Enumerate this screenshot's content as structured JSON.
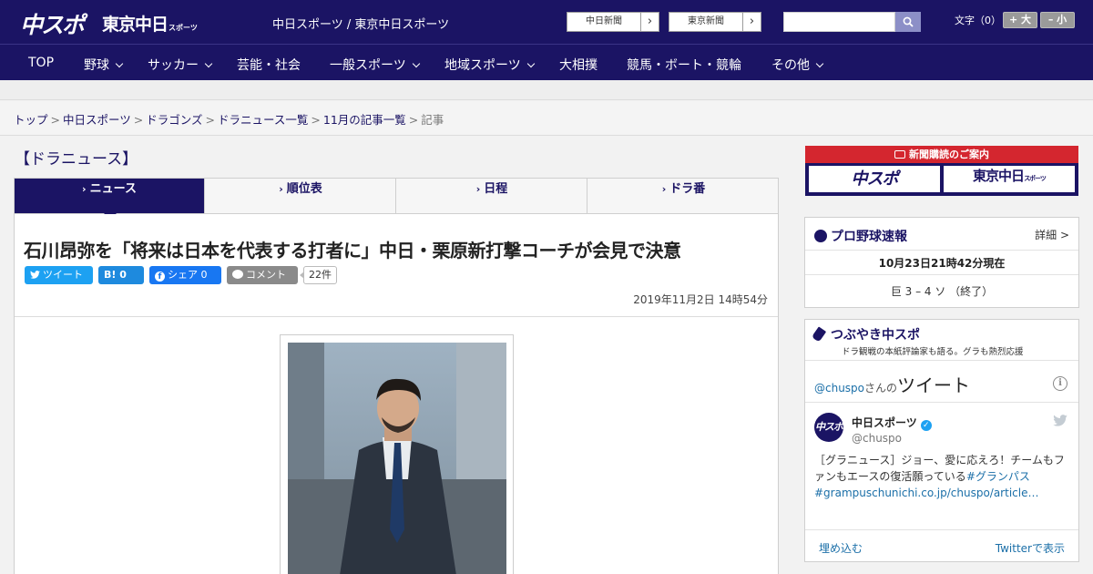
{
  "header": {
    "logo": "中スポ",
    "logo2": "東京中日",
    "logo2_small": "スポーツ",
    "site_links": "中日スポーツ / 東京中日スポーツ",
    "paper_buttons": [
      "中日新聞",
      "東京新聞"
    ],
    "font_size_label": "文字（0）",
    "font_larger": "+ 大",
    "font_smaller": "– 小"
  },
  "nav": {
    "items": [
      "TOP",
      "野球",
      "サッカー",
      "芸能・社会",
      "一般スポーツ",
      "地域スポーツ",
      "大相撲",
      "競馬・ボート・競輪",
      "その他"
    ]
  },
  "breadcrumb": [
    "トップ",
    "中日スポーツ",
    "ドラゴンズ",
    "ドラニュース一覧",
    "11月の記事一覧",
    "記事"
  ],
  "section_title": "【ドラニュース】",
  "tabs": [
    "ニュース",
    "順位表",
    "日程",
    "ドラ番"
  ],
  "article": {
    "headline": "石川昂弥を「将来は日本を代表する打者に」中日・栗原新打撃コーチが会見で決意",
    "share": {
      "tweet": "ツイート",
      "hatena": "B! 0",
      "facebook": "シェア 0",
      "comment": "コメント",
      "comment_count": "22件"
    },
    "date": "2019年11月2日 14時54分"
  },
  "sidebar": {
    "subscribe_heading": "新聞購読のご案内",
    "subscribe_logo1": "中スポ",
    "subscribe_logo2": "東京中日",
    "subscribe_logo2_small": "スポーツ",
    "baseball": {
      "title": "プロ野球速報",
      "more": "詳細 >",
      "time": "10月23日21時42分現在",
      "score": "巨 3 – 4 ソ （終了）"
    },
    "tweets": {
      "title": "つぶやき中スポ",
      "subtitle": "ドラ観戦の本紙評論家も語る。グラも熱烈応援",
      "handle": "@chuspo",
      "handle_suffix": "さんの",
      "heading": "ツイート",
      "avatar_text": "中スポ",
      "name": "中日スポーツ",
      "user": "@chuspo",
      "text": "［グラニュース］ジョー、愛に応えろ！チームもファンもエースの復活願っている",
      "hashtag": "#グランパス",
      "link": "#grampuschunichi.co.jp/chuspo/article…",
      "embed": "埋め込む",
      "view_on_twitter": "Twitterで表示"
    }
  },
  "colors": {
    "brand_navy": "#1b1464",
    "accent_red": "#d4262f",
    "twitter_blue": "#1da1f2",
    "facebook_blue": "#1877f2"
  }
}
